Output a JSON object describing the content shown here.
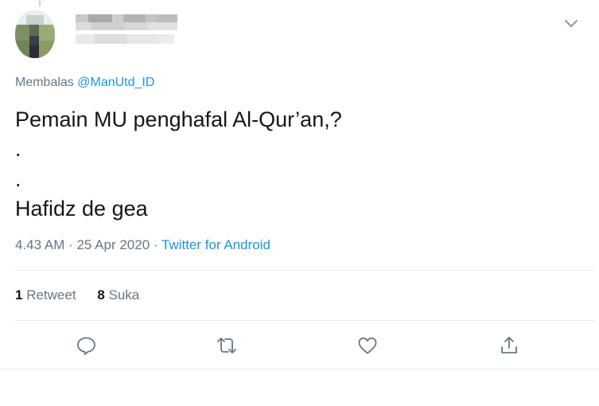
{
  "tweet": {
    "reply_prefix": "Membalas ",
    "reply_handle": "@ManUtd_ID",
    "lines": [
      "Pemain MU penghafal Al-Qur’an,?",
      ".",
      ".",
      "Hafidz de gea"
    ],
    "timestamp": "4.43 AM · 25 Apr 2020 · ",
    "source": "Twitter for Android"
  },
  "stats": {
    "retweets_count": "1",
    "retweets_label": "Retweet",
    "likes_count": "8",
    "likes_label": "Suka"
  },
  "colors": {
    "link": "#1b95e0",
    "muted": "#657786",
    "text": "#14171a",
    "icon": "#657786",
    "divider": "#e6ecf0"
  },
  "icons": [
    "chevron-down-icon",
    "reply-icon",
    "retweet-icon",
    "like-icon",
    "share-icon"
  ]
}
